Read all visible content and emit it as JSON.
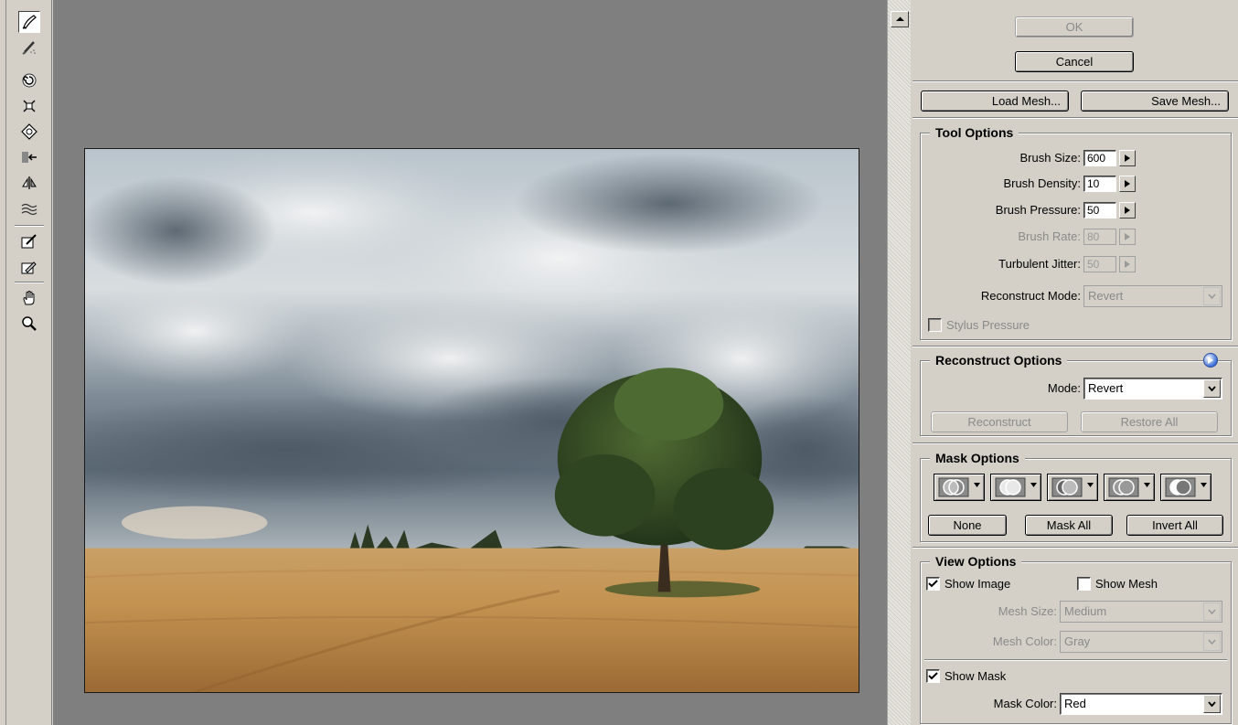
{
  "toolbar": {
    "tools": [
      {
        "name": "forward-warp-tool-icon",
        "active": true
      },
      {
        "name": "reconstruct-tool-icon"
      },
      {
        "name": "twirl-clockwise-tool-icon"
      },
      {
        "name": "pucker-tool-icon"
      },
      {
        "name": "bloat-tool-icon"
      },
      {
        "name": "push-left-tool-icon"
      },
      {
        "name": "mirror-tool-icon"
      },
      {
        "name": "turbulence-tool-icon"
      },
      {
        "name": "freeze-mask-tool-icon"
      },
      {
        "name": "thaw-mask-tool-icon"
      },
      {
        "name": "hand-tool-icon"
      },
      {
        "name": "zoom-tool-icon"
      }
    ]
  },
  "dialog": {
    "ok_label": "OK",
    "cancel_label": "Cancel",
    "load_mesh_label": "Load Mesh...",
    "save_mesh_label": "Save Mesh..."
  },
  "tool_options": {
    "title": "Tool Options",
    "brush_size_label": "Brush Size:",
    "brush_size_value": "600",
    "brush_density_label": "Brush Density:",
    "brush_density_value": "10",
    "brush_pressure_label": "Brush Pressure:",
    "brush_pressure_value": "50",
    "brush_rate_label": "Brush Rate:",
    "brush_rate_value": "80",
    "turbulent_jitter_label": "Turbulent Jitter:",
    "turbulent_jitter_value": "50",
    "reconstruct_mode_label": "Reconstruct Mode:",
    "reconstruct_mode_value": "Revert",
    "stylus_pressure_label": "Stylus Pressure"
  },
  "reconstruct_options": {
    "title": "Reconstruct Options",
    "mode_label": "Mode:",
    "mode_value": "Revert",
    "reconstruct_label": "Reconstruct",
    "restore_all_label": "Restore All"
  },
  "mask_options": {
    "title": "Mask Options",
    "none_label": "None",
    "mask_all_label": "Mask All",
    "invert_all_label": "Invert All"
  },
  "view_options": {
    "title": "View Options",
    "show_image_label": "Show Image",
    "show_image_checked": true,
    "show_mesh_label": "Show Mesh",
    "show_mesh_checked": false,
    "mesh_size_label": "Mesh Size:",
    "mesh_size_value": "Medium",
    "mesh_color_label": "Mesh Color:",
    "mesh_color_value": "Gray",
    "show_mask_label": "Show Mask",
    "show_mask_checked": true,
    "mask_color_label": "Mask Color:",
    "mask_color_value": "Red"
  },
  "colors": {
    "panel_bg": "#d4d0c8",
    "canvas_bg": "#7f7f7f",
    "field": "#c79a5a",
    "sky": "#9aa7b1"
  }
}
